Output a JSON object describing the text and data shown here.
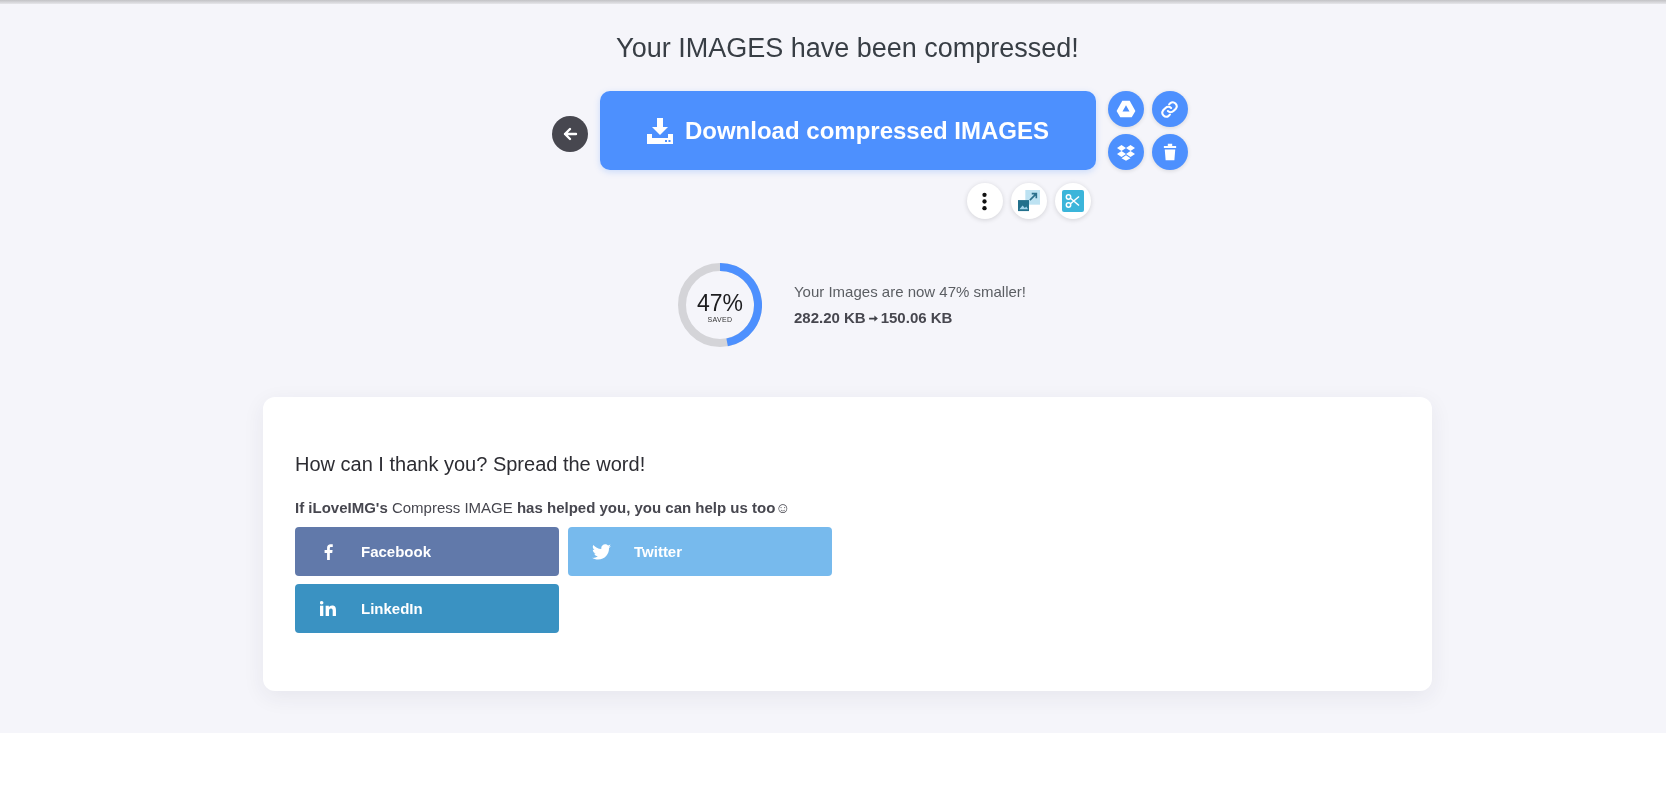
{
  "page": {
    "title": "Your IMAGES have been compressed!"
  },
  "download": {
    "label": "Download compressed IMAGES"
  },
  "savings": {
    "percent": "47%",
    "caption": "SAVED",
    "level": 0.47,
    "message": "Your Images are now 47% smaller!",
    "size_before": "282.20 KB",
    "size_after": "150.06 KB"
  },
  "share_card": {
    "heading": "How can I thank you? Spread the word!",
    "message": "**If iLoveIMG's** Compress IMAGE **has helped you, you can help us too**☺",
    "buttons": [
      {
        "kind": "facebook",
        "label": "Facebook",
        "color": "#6179aa"
      },
      {
        "kind": "twitter",
        "label": "Twitter",
        "color": "#77baed"
      },
      {
        "kind": "linkedin",
        "label": "LinkedIn",
        "color": "#3a92c2"
      }
    ]
  }
}
